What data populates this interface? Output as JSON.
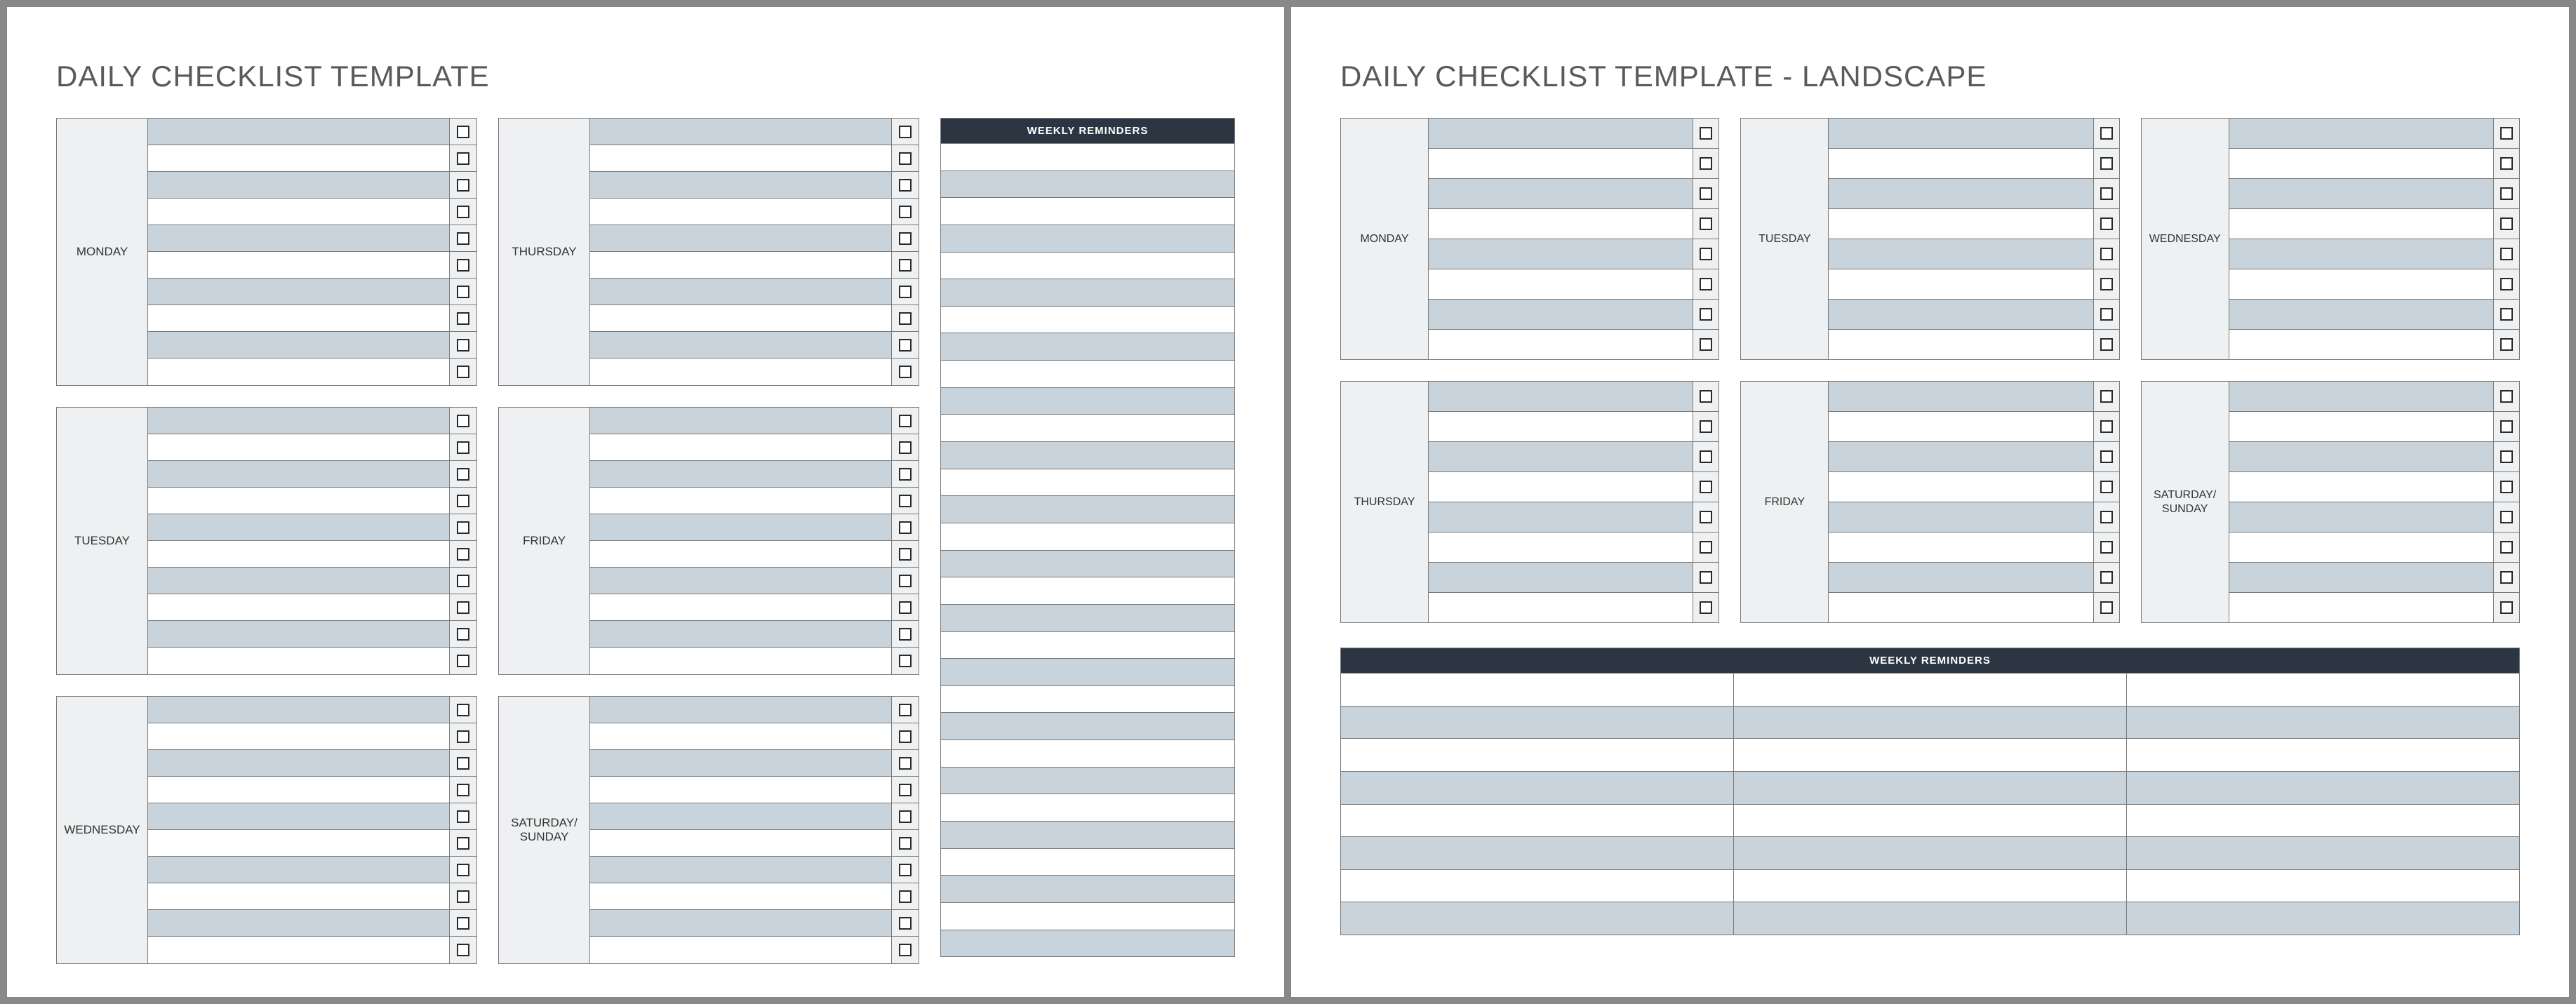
{
  "portrait": {
    "title": "DAILY CHECKLIST TEMPLATE",
    "days_col1": [
      {
        "label": "MONDAY",
        "rows": 10
      },
      {
        "label": "TUESDAY",
        "rows": 10
      },
      {
        "label": "WEDNESDAY",
        "rows": 10
      }
    ],
    "days_col2": [
      {
        "label": "THURSDAY",
        "rows": 10
      },
      {
        "label": "FRIDAY",
        "rows": 10
      },
      {
        "label": "SATURDAY/ SUNDAY",
        "rows": 10
      }
    ],
    "reminders_header": "WEEKLY REMINDERS",
    "reminders_rows": 30
  },
  "landscape": {
    "title": "DAILY CHECKLIST TEMPLATE - LANDSCAPE",
    "days": [
      {
        "label": "MONDAY",
        "rows": 8
      },
      {
        "label": "TUESDAY",
        "rows": 8
      },
      {
        "label": "WEDNESDAY",
        "rows": 8
      },
      {
        "label": "THURSDAY",
        "rows": 8
      },
      {
        "label": "FRIDAY",
        "rows": 8
      },
      {
        "label": "SATURDAY/ SUNDAY",
        "rows": 8
      }
    ],
    "reminders_header": "WEEKLY REMINDERS",
    "reminders_rows": 8,
    "reminders_cols": 3
  },
  "colors": {
    "alt_row": "#c9d3db",
    "label_bg": "#eef0f2",
    "header_bg": "#2c3642",
    "border": "#7a7a7a"
  }
}
